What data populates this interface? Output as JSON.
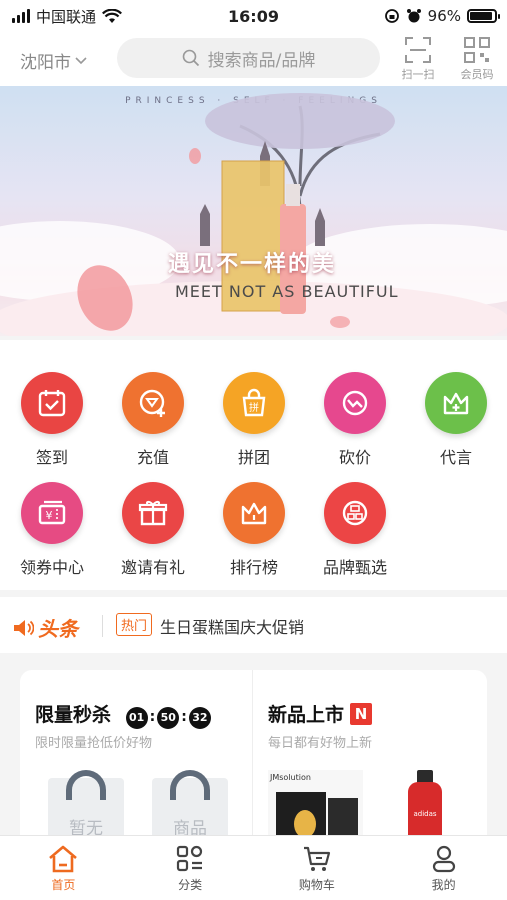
{
  "status_bar": {
    "carrier": "中国联通",
    "time": "16:09",
    "battery": "96%"
  },
  "header": {
    "city": "沈阳市",
    "search_placeholder": "搜索商品/品牌",
    "scan_label": "扫一扫",
    "member_code_label": "会员码"
  },
  "banner": {
    "top_text": "PRINCESS · SELF · FEELINGS",
    "headline_cn": "遇见不一样的美",
    "headline_en": "MEET NOT AS BEAUTIFUL"
  },
  "quick_menu": [
    {
      "label": "签到",
      "icon": "calendar-check-icon",
      "color": "#e94543"
    },
    {
      "label": "充值",
      "icon": "recharge-icon",
      "color": "#ef7230"
    },
    {
      "label": "拼团",
      "icon": "group-buy-bag-icon",
      "color": "#f5a425"
    },
    {
      "label": "砍价",
      "icon": "bargain-icon",
      "color": "#e6488e"
    },
    {
      "label": "代言",
      "icon": "crown-plus-icon",
      "color": "#6cc04a"
    },
    {
      "label": "领券中心",
      "icon": "coupon-icon",
      "color": "#e64b83"
    },
    {
      "label": "邀请有礼",
      "icon": "gift-icon",
      "color": "#ea4646"
    },
    {
      "label": "排行榜",
      "icon": "crown-icon",
      "color": "#ef7230"
    },
    {
      "label": "品牌甄选",
      "icon": "brand-badge-icon",
      "color": "#ec4545"
    }
  ],
  "news": {
    "logo": "头条",
    "tag": "热门",
    "headline": "生日蛋糕国庆大促销"
  },
  "flash_sale": {
    "title": "限量秒杀",
    "countdown": [
      "01",
      "50",
      "32"
    ],
    "subtitle": "限时限量抢低价好物",
    "placeholders": [
      "暂无",
      "商品"
    ]
  },
  "new_arrivals": {
    "title": "新品上市",
    "badge": "N",
    "subtitle": "每日都有好物上新",
    "product1_brand": "JMsolution",
    "product2_brand": "adidas"
  },
  "tabbar": [
    {
      "label": "首页",
      "icon": "home-icon",
      "active": true
    },
    {
      "label": "分类",
      "icon": "category-icon",
      "active": false
    },
    {
      "label": "购物车",
      "icon": "cart-icon",
      "active": false
    },
    {
      "label": "我的",
      "icon": "user-icon",
      "active": false
    }
  ]
}
